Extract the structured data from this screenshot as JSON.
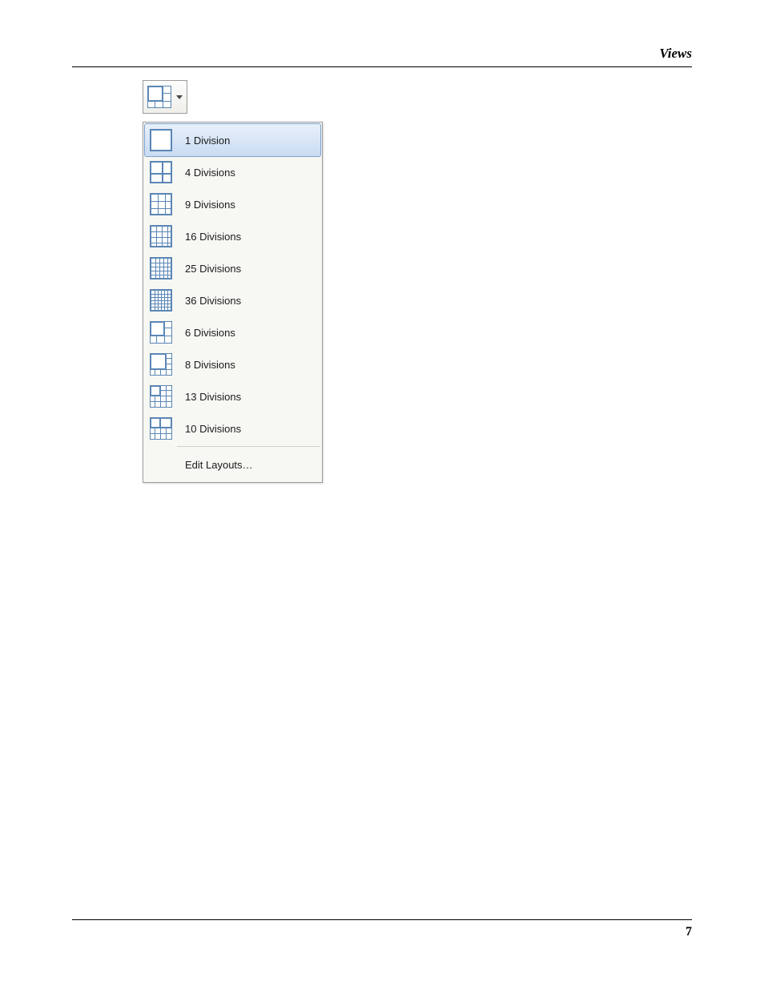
{
  "header": {
    "title": "Views"
  },
  "footer": {
    "page_number": "7"
  },
  "toolbar": {
    "button_name": "layout-dropdown"
  },
  "menu": {
    "items": [
      {
        "label": "1 Division",
        "selected": true,
        "icon": "grid-1"
      },
      {
        "label": "4 Divisions",
        "selected": false,
        "icon": "grid-2x2"
      },
      {
        "label": "9 Divisions",
        "selected": false,
        "icon": "grid-3x3"
      },
      {
        "label": "16 Divisions",
        "selected": false,
        "icon": "grid-4x4"
      },
      {
        "label": "25 Divisions",
        "selected": false,
        "icon": "grid-5x5"
      },
      {
        "label": "36 Divisions",
        "selected": false,
        "icon": "grid-6x6"
      },
      {
        "label": "6 Divisions",
        "selected": false,
        "icon": "layout-6"
      },
      {
        "label": "8 Divisions",
        "selected": false,
        "icon": "layout-8"
      },
      {
        "label": "13 Divisions",
        "selected": false,
        "icon": "layout-13"
      },
      {
        "label": "10 Divisions",
        "selected": false,
        "icon": "layout-10"
      }
    ],
    "edit_label": "Edit Layouts…"
  }
}
